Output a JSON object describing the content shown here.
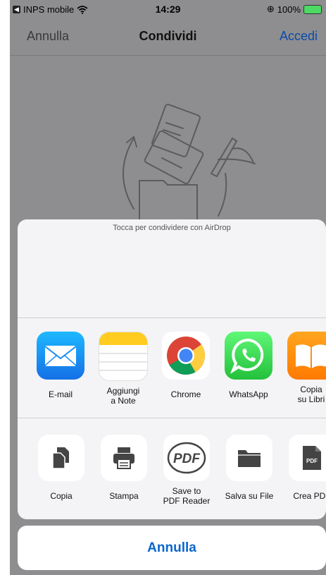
{
  "status_bar": {
    "back_app": "INPS mobile",
    "time": "14:29",
    "battery": "100%"
  },
  "nav": {
    "left": "Annulla",
    "title": "Condividi",
    "right": "Accedi"
  },
  "share_sheet": {
    "airdrop_hint": "Tocca per condividere con AirDrop",
    "apps": [
      {
        "label": "E-mail",
        "icon": "mail-icon"
      },
      {
        "label": "Aggiungi\na Note",
        "icon": "notes-icon"
      },
      {
        "label": "Chrome",
        "icon": "chrome-icon"
      },
      {
        "label": "WhatsApp",
        "icon": "whatsapp-icon"
      },
      {
        "label": "Copia\nsu Libri",
        "icon": "books-icon"
      }
    ],
    "actions": [
      {
        "label": "Copia",
        "icon": "copy-icon"
      },
      {
        "label": "Stampa",
        "icon": "printer-icon"
      },
      {
        "label": "Save to\nPDF Reader",
        "icon": "pdf-reader-icon",
        "icon_text": "PDF"
      },
      {
        "label": "Salva su File",
        "icon": "folder-icon"
      },
      {
        "label": "Crea PDF",
        "icon": "pdf-file-icon",
        "icon_text": "PDF"
      }
    ],
    "cancel": "Annulla"
  },
  "colors": {
    "accent": "#0a66cc",
    "overlay": "#8e8e90",
    "sheet": "#f4f4f6"
  }
}
